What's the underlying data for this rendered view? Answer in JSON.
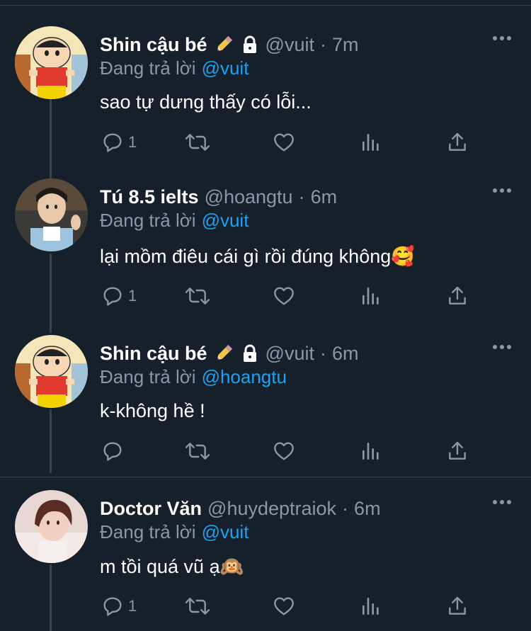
{
  "colors": {
    "background": "#15202b",
    "text_primary": "#ffffff",
    "text_secondary": "#8899a6",
    "link": "#1da1f2",
    "divider": "#38444d"
  },
  "tweets": [
    {
      "author_name": "Shin cậu bé",
      "badges": [
        "pencil-icon",
        "lock-icon"
      ],
      "handle": "@vuit",
      "separator": "·",
      "time": "7m",
      "reply_prefix": "Đang trả lời",
      "reply_to": "@vuit",
      "text": "sao tự dưng thấy có lỗi...",
      "emoji": "",
      "reply_count": "1",
      "avatar": "shin-avatar"
    },
    {
      "author_name": "Tú 8.5 ielts",
      "badges": [],
      "handle": "@hoangtu",
      "separator": "·",
      "time": "6m",
      "reply_prefix": "Đang trả lời",
      "reply_to": "@vuit",
      "text": "lại mồm điêu cái gì rồi đúng không",
      "emoji": "🥰",
      "reply_count": "1",
      "avatar": "tu-avatar"
    },
    {
      "author_name": "Shin cậu bé",
      "badges": [
        "pencil-icon",
        "lock-icon"
      ],
      "handle": "@vuit",
      "separator": "·",
      "time": "6m",
      "reply_prefix": "Đang trả lời",
      "reply_to": "@hoangtu",
      "text": "k-không hề !",
      "emoji": "",
      "reply_count": "",
      "avatar": "shin-avatar"
    },
    {
      "author_name": "Doctor Văn",
      "badges": [],
      "handle": "@huydeptraiok",
      "separator": "·",
      "time": "6m",
      "reply_prefix": "Đang trả lời",
      "reply_to": "@vuit",
      "text": "m tồi quá vũ ạ",
      "emoji": "🙉",
      "reply_count": "1",
      "avatar": "doctor-avatar"
    }
  ],
  "action_icons": [
    "reply-icon",
    "retweet-icon",
    "like-icon",
    "analytics-icon",
    "share-icon"
  ]
}
